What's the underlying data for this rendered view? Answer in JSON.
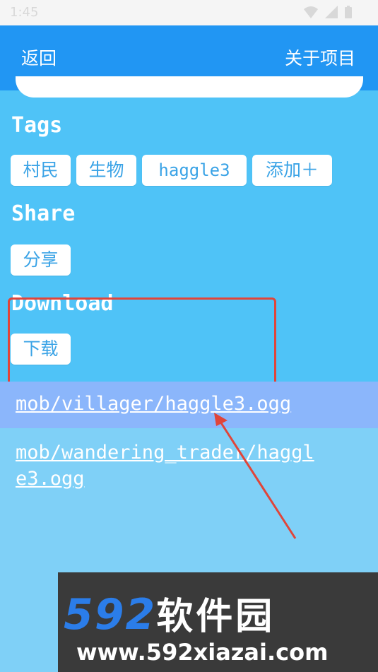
{
  "status_bar": {
    "time": "1:45",
    "icons": [
      "wifi-icon",
      "signal-icon",
      "battery-icon"
    ]
  },
  "app_bar": {
    "back_label": "返回",
    "about_label": "关于项目",
    "color": "#2196f3"
  },
  "sections": {
    "tags_title": "Tags",
    "share_title": "Share",
    "download_title": "Download"
  },
  "tags": {
    "items": [
      "村民",
      "生物",
      "haggle3"
    ],
    "add_label": "添加＋"
  },
  "share": {
    "button_label": "分享"
  },
  "download": {
    "button_label": "下载"
  },
  "files": {
    "items": [
      {
        "path_line1": "mob/villager/haggle3.ogg",
        "path_line2": ""
      },
      {
        "path_line1": "mob/wandering_trader/haggl",
        "path_line2": "e3.ogg"
      }
    ]
  },
  "watermark": {
    "brand_number": "592",
    "brand_text": "软件园",
    "url": "www.592xiazai.com"
  },
  "colors": {
    "content_bg": "#4fc3f7",
    "page_bg": "#7fd0f7",
    "chip_text": "#3aa3e6",
    "highlight": "#e0453a",
    "selected_row": "#8bb6fb"
  }
}
